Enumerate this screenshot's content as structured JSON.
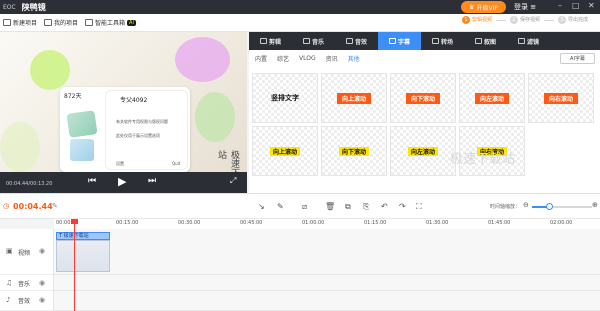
{
  "titlebar": {
    "logo_text": "EOC",
    "app_name": "陕鸭镜",
    "window_title": "",
    "upgrade_label": "升级VIP",
    "login_label": "登录",
    "min_icon": "minimize-icon",
    "max_icon": "maximize-icon",
    "close_icon": "close-icon"
  },
  "menubar": {
    "items": [
      {
        "label": "新建项目",
        "icon": "new-project-icon"
      },
      {
        "label": "我的项目",
        "icon": "folder-icon"
      },
      {
        "label": "智能工具箱",
        "icon": "toolbox-icon",
        "badge": "AI"
      }
    ]
  },
  "steps": [
    {
      "num": "1",
      "label": "剪辑视频",
      "active": true
    },
    {
      "num": "2",
      "label": "保存视频",
      "active": false
    },
    {
      "num": "3",
      "label": "导出完成",
      "active": false
    }
  ],
  "preview": {
    "stat_a": "872天",
    "user_name": "专父4092",
    "vertical_caption": "极速下载站",
    "current_time": "00:04.44/00:13.20",
    "card_lines": [
      "有关软件专用权限与版权问题",
      "此处仅用于展示设置选项",
      "设置",
      "Quit"
    ],
    "controls": {
      "prev_icon": "skip-back-icon",
      "play_icon": "play-icon",
      "next_icon": "skip-forward-icon",
      "fullscreen_icon": "fullscreen-icon"
    }
  },
  "tabs": [
    {
      "label": "剪辑",
      "icon": "cut-icon",
      "active": false
    },
    {
      "label": "音乐",
      "icon": "music-icon",
      "active": false
    },
    {
      "label": "音效",
      "icon": "sound-effect-icon",
      "active": false
    },
    {
      "label": "字幕",
      "icon": "subtitle-icon",
      "active": true
    },
    {
      "label": "转场",
      "icon": "transition-icon",
      "active": false
    },
    {
      "label": "叙图",
      "icon": "sticker-icon",
      "active": false
    },
    {
      "label": "滤镜",
      "icon": "filter-icon",
      "active": false
    }
  ],
  "subtabs": [
    {
      "label": "内置",
      "active": false
    },
    {
      "label": "综艺",
      "active": false
    },
    {
      "label": "VLOG",
      "active": false
    },
    {
      "label": "资讯",
      "active": false
    },
    {
      "label": "其他",
      "active": true
    }
  ],
  "ai_subtitle_button": "AI字幕",
  "presets": [
    {
      "text": "竖排文字",
      "style": "vertical"
    },
    {
      "text": "向上滚动",
      "style": "chip"
    },
    {
      "text": "向下滚动",
      "style": "chip"
    },
    {
      "text": "向左滚动",
      "style": "chip"
    },
    {
      "text": "向右滚动",
      "style": "chip"
    },
    {
      "text": "向上滚动",
      "style": "yellow"
    },
    {
      "text": "向下滚动",
      "style": "yellow"
    },
    {
      "text": "向左滚动",
      "style": "yellow"
    },
    {
      "text": "向右滚动",
      "style": "yellow"
    }
  ],
  "watermark_text": "极速下载站",
  "toolbar": {
    "current_time": "00:04.44",
    "zoom_label": "时间轴缩放：",
    "zoom_level": 0.28,
    "tools": [
      "split-icon",
      "pen-icon",
      "crop-icon",
      "delete-icon",
      "copy-icon",
      "paste-icon",
      "undo-icon",
      "redo-icon",
      "fullscreen-capture-icon"
    ]
  },
  "ruler": {
    "ticks": [
      "00:00.00",
      "00:15.00",
      "00:30.00",
      "00:45.00",
      "01:00.00",
      "01:15.00",
      "01:30.00",
      "01:45.00",
      "02:00.00"
    ]
  },
  "tracks": [
    {
      "label": "视频",
      "icon": "video-track-icon"
    },
    {
      "label": "音乐",
      "icon": "music-track-icon"
    },
    {
      "label": "音效",
      "icon": "sound-track-icon"
    }
  ],
  "clips": {
    "subtitle_clip": "T 极速下载站"
  },
  "colors": {
    "accent": "#3e8ef7",
    "orange": "#ff5a14",
    "yellow": "#ffe600",
    "dark": "#2b2e35"
  }
}
